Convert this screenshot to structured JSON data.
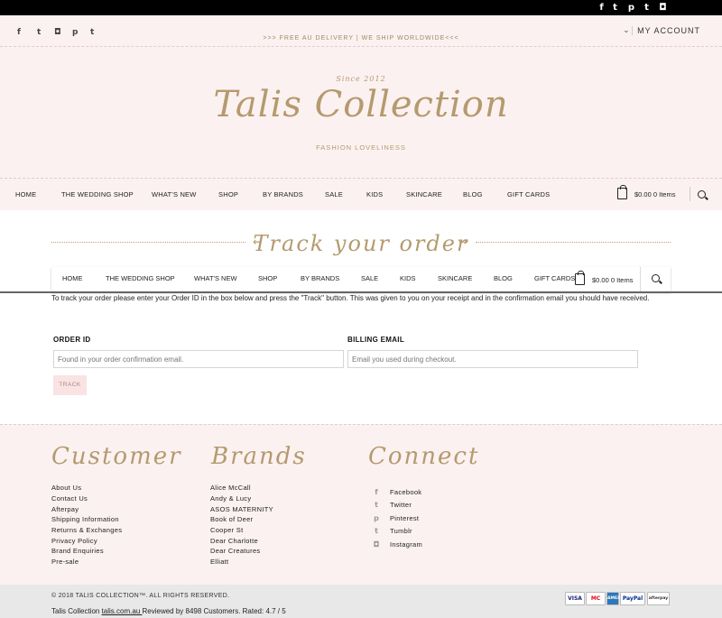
{
  "topbar": {
    "social_icons": [
      "facebook-icon",
      "twitter-icon",
      "pinterest-icon",
      "tumblr-icon",
      "instagram-icon"
    ],
    "glyphs": [
      "f",
      "t",
      "p",
      "t",
      "◘"
    ]
  },
  "header": {
    "social_glyphs": [
      "f",
      "t",
      "◘",
      "p",
      "t"
    ],
    "promo": ">>> FREE AU DELIVERY | WE SHIP WORLDWIDE<<<",
    "account": "MY ACCOUNT",
    "logo_since": "Since 2012",
    "logo_title": "Talis Collection",
    "tagline": "FASHION LOVELINESS"
  },
  "nav": {
    "items": [
      "HOME",
      "THE WEDDING SHOP",
      "WHAT'S NEW",
      "SHOP",
      "BY BRANDS",
      "SALE",
      "KIDS",
      "SKINCARE",
      "BLOG",
      "GIFT CARDS"
    ],
    "cart_text": "$0.00 0 Items"
  },
  "sticky_nav": {
    "items": [
      "HOME",
      "THE WEDDING SHOP",
      "WHAT'S NEW",
      "SHOP",
      "BY BRANDS",
      "SALE",
      "KIDS",
      "SKINCARE",
      "BLOG",
      "GIFT CARDS"
    ],
    "cart_text": "$0.00 0 Items"
  },
  "page": {
    "title": "Track your order",
    "intro": "To track your order please enter your Order ID in the box below and press the \"Track\" button. This was given to you on your receipt and in the confirmation email you should have received."
  },
  "form": {
    "order_id_label": "ORDER ID",
    "order_id_placeholder": "Found in your order confirmation email.",
    "email_label": "BILLING EMAIL",
    "email_placeholder": "Email you used during checkout.",
    "button": "TRACK"
  },
  "footer": {
    "customer": {
      "heading": "Customer",
      "links": [
        "About Us",
        "Contact Us",
        "Afterpay",
        "Shipping Information",
        "Returns & Exchanges",
        "Privacy Policy",
        "Brand Enquiries",
        "Pre-sale"
      ]
    },
    "brands": {
      "heading": "Brands",
      "links": [
        "Alice McCall",
        "Andy & Lucy",
        "ASOS MATERNITY",
        "Book of Deer",
        "Cooper St",
        "Dear Charlotte",
        "Dear Creatures",
        "Elliatt"
      ]
    },
    "connect": {
      "heading": "Connect",
      "links": [
        "Facebook",
        "Twitter",
        "Pinterest",
        "Tumblr",
        "Instagram"
      ],
      "glyphs": [
        "f",
        "t",
        "p",
        "t",
        "◘"
      ]
    }
  },
  "bottom": {
    "copyright": "© 2018 TALIS COLLECTION™. ALL RIGHTS RESERVED.",
    "reviews_prefix": "Talis Collection ",
    "reviews_link": "talis.com.au ",
    "reviews_suffix": "Reviewed by 8498 Customers. Rated: 4.7 / 5",
    "payments": [
      "VISA",
      "MC",
      "AMEX",
      "PayPal",
      "afterpay"
    ]
  }
}
